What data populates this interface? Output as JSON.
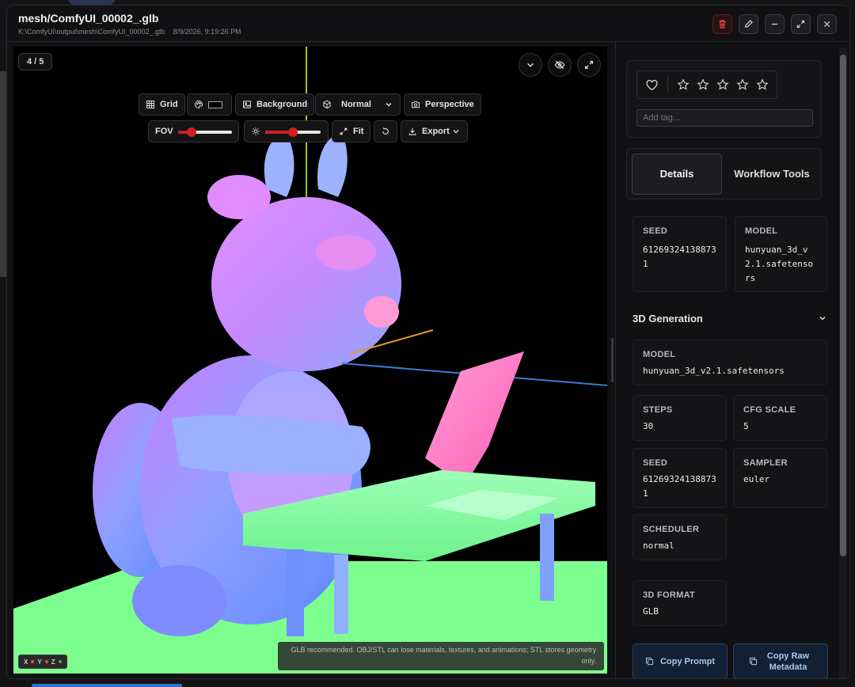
{
  "window": {
    "title": "mesh/ComfyUI_00002_.glb",
    "path": "K:\\ComfyUI\\output\\mesh\\ComfyUI_00002_.glb",
    "date": "8/9/2026, 9:19:26 PM"
  },
  "header_buttons": [
    "trash-icon",
    "pencil-icon",
    "minimize-icon",
    "expand-icon",
    "close-icon"
  ],
  "viewer": {
    "counter": "4 / 5",
    "toolbar": {
      "grid": "Grid",
      "background": "Background",
      "material": "Normal",
      "camera": "Perspective",
      "fov_label": "FOV",
      "fit": "Fit",
      "export": "Export",
      "fov_level": 0.25,
      "light_level": 0.5,
      "swatch_color": "#000000"
    },
    "axes_legend": [
      {
        "label": "X",
        "color": "#e0533b"
      },
      {
        "label": "Y",
        "color": "#e0533b"
      },
      {
        "label": "Z",
        "color": "#4aa35a"
      }
    ],
    "note": "GLB recommended. OBJ/STL can lose materials, textures, and animations; STL stores geometry only.",
    "scene_colors": {
      "floor": "#7dff8f",
      "axis_y": "#d6ff3a",
      "axis_x": "#e59a2d",
      "axis_z": "#3b7bd6"
    }
  },
  "sidebar": {
    "tag_placeholder": "Add tag...",
    "tabs": [
      "Details",
      "Workflow Tools"
    ],
    "summary": [
      {
        "label": "SEED",
        "value": "612693241388731"
      },
      {
        "label": "MODEL",
        "value": "hunyuan_3d_v2.1.safetensors"
      }
    ],
    "section_title": "3D Generation",
    "generation": {
      "model": {
        "label": "MODEL",
        "value": "hunyuan_3d_v2.1.safetensors"
      },
      "steps": {
        "label": "STEPS",
        "value": "30"
      },
      "cfg": {
        "label": "CFG SCALE",
        "value": "5"
      },
      "seed": {
        "label": "SEED",
        "value": "612693241388731"
      },
      "sampler": {
        "label": "SAMPLER",
        "value": "euler"
      },
      "scheduler": {
        "label": "SCHEDULER",
        "value": "normal"
      },
      "format": {
        "label": "3D FORMAT",
        "value": "GLB"
      }
    },
    "copy_prompt": "Copy Prompt",
    "copy_raw": "Copy Raw Metadata"
  }
}
